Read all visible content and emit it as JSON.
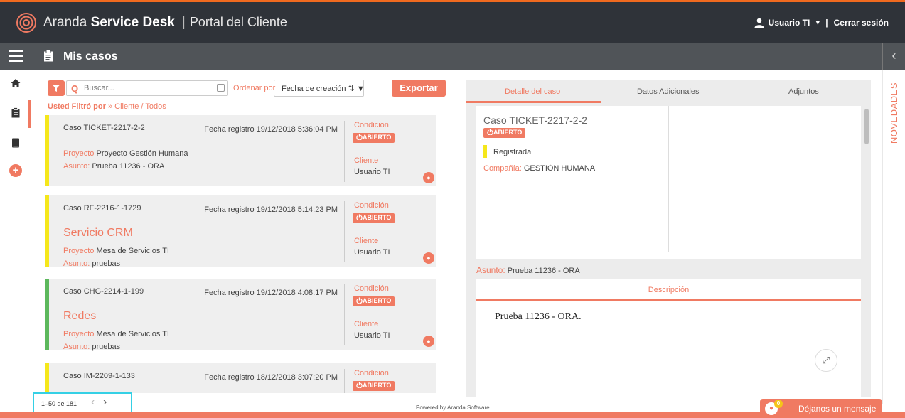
{
  "header": {
    "brand_light": "Aranda",
    "brand_bold": "Service Desk",
    "separator": "|",
    "portal": "Portal del Cliente",
    "user": "Usuario TI",
    "logout": "Cerrar sesión"
  },
  "toolbar": {
    "page_title": "Mis casos"
  },
  "list": {
    "search_placeholder": "Buscar...",
    "order_label": "Ordenar por",
    "order_value": "Fecha de creación ⇅",
    "export_label": "Exportar",
    "filtered_label": "Usted Filtró por",
    "filtered_value": "» Cliente / Todos",
    "cards": [
      {
        "id": "Caso TICKET-2217-2-2",
        "fecha": "Fecha registro 19/12/2018 5:36:04 PM",
        "condicion_label": "Condición",
        "estado": "ABIERTO",
        "categoria": "",
        "proyecto_label": "Proyecto",
        "proyecto": "Proyecto Gestión Humana",
        "asunto_label": "Asunto:",
        "asunto": "Prueba 11236 - ORA",
        "cliente_label": "Cliente",
        "cliente": "Usuario TI",
        "color": "#f5e71b"
      },
      {
        "id": "Caso RF-2216-1-1729",
        "fecha": "Fecha registro 19/12/2018 5:14:23 PM",
        "condicion_label": "Condición",
        "estado": "ABIERTO",
        "categoria": "Servicio CRM",
        "proyecto_label": "Proyecto",
        "proyecto": "Mesa de Servicios TI",
        "asunto_label": "Asunto:",
        "asunto": "pruebas",
        "cliente_label": "Cliente",
        "cliente": "Usuario TI",
        "color": "#f5e71b"
      },
      {
        "id": "Caso CHG-2214-1-199",
        "fecha": "Fecha registro 19/12/2018 4:08:17 PM",
        "condicion_label": "Condición",
        "estado": "ABIERTO",
        "categoria": "Redes",
        "proyecto_label": "Proyecto",
        "proyecto": "Mesa de Servicios TI",
        "asunto_label": "Asunto:",
        "asunto": "pruebas",
        "cliente_label": "Cliente",
        "cliente": "Usuario TI",
        "color": "#5cb85c"
      },
      {
        "id": "Caso IM-2209-1-133",
        "fecha": "Fecha registro 18/12/2018 3:07:20 PM",
        "condicion_label": "Condición",
        "estado": "ABIERTO",
        "categoria": "",
        "proyecto_label": "",
        "proyecto": "",
        "asunto_label": "",
        "asunto": "",
        "cliente_label": "",
        "cliente": "",
        "color": "#f5e71b"
      }
    ],
    "pager": "1–50 de 181"
  },
  "detail": {
    "tabs": [
      "Detalle del caso",
      "Datos Adicionales",
      "Adjuntos"
    ],
    "case_title": "Caso TICKET-2217-2-2",
    "estado": "ABIERTO",
    "state": "Registrada",
    "company_label": "Compañía:",
    "company": "GESTIÓN HUMANA",
    "asunto_label": "Asunto:",
    "asunto": "Prueba 11236 - ORA",
    "desc_title": "Descripción",
    "desc_text": "Prueba 11236 - ORA."
  },
  "side": {
    "novedades": "NOVEDADES"
  },
  "footer": {
    "powered": "Powered by Aranda Software",
    "chat_count": "0",
    "chat_label": "Déjanos un mensaje"
  },
  "colors": {
    "accent": "#f07a62",
    "header_bg": "#2f3339",
    "toolbar_bg": "#505458"
  }
}
